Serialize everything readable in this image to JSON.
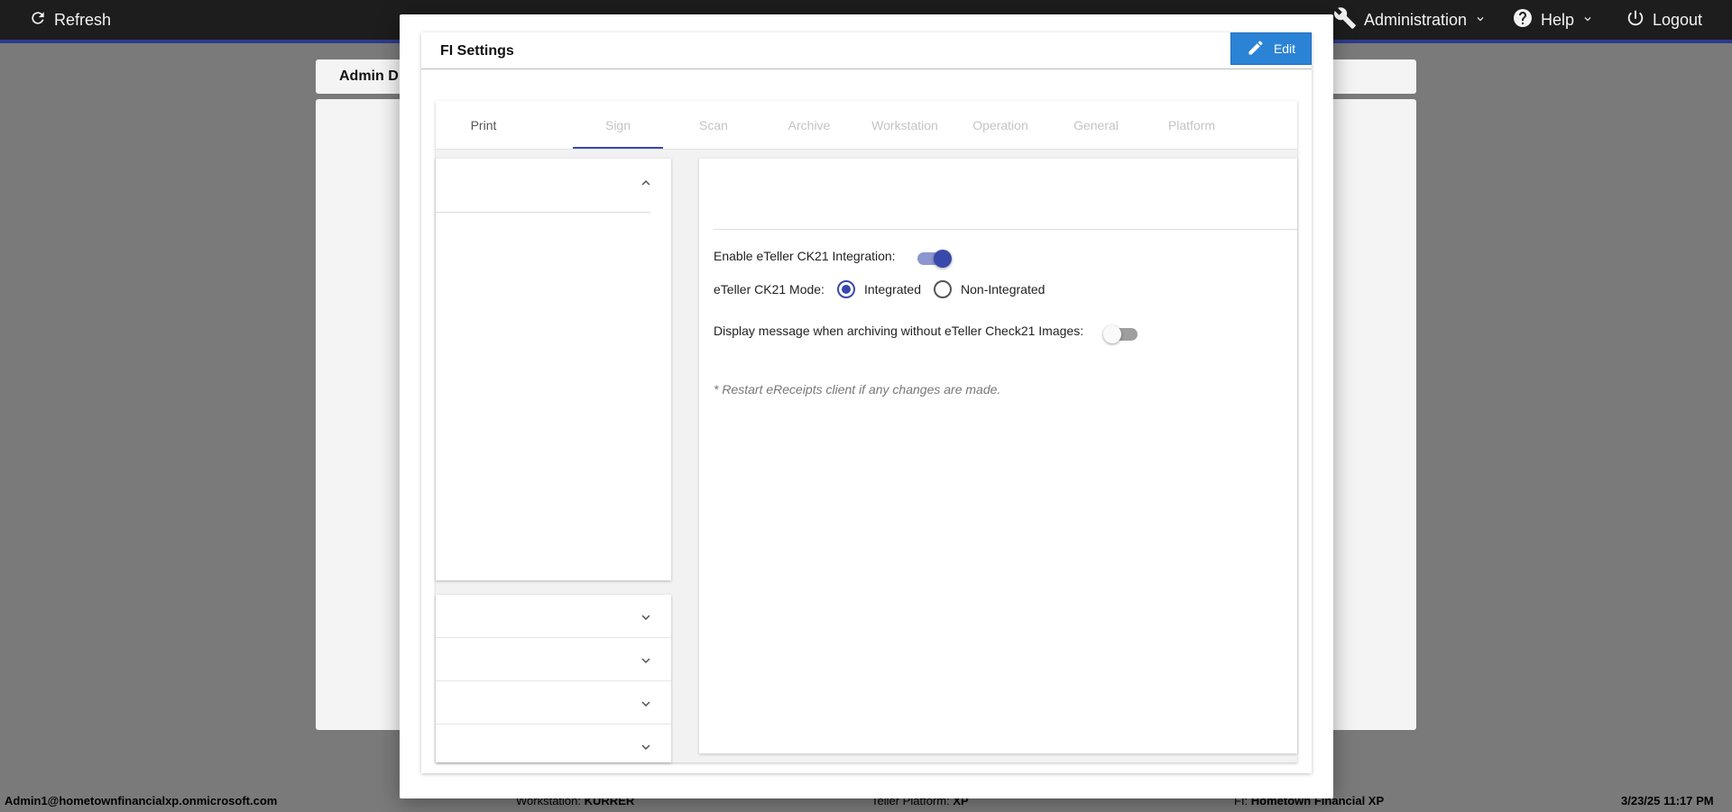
{
  "topbar": {
    "refresh_label": "Refresh",
    "administration_label": "Administration",
    "help_label": "Help",
    "logout_label": "Logout",
    "accent_color": "#2d3a8c"
  },
  "background": {
    "header_title": "Admin D"
  },
  "footer": {
    "user": "Admin1@hometownfinancialxp.onmicrosoft.com",
    "workstation_label": "Workstation:",
    "workstation_value": "KURRER",
    "platform_label": "Teller Platform:",
    "platform_value": "XP",
    "fi_label": "FI:",
    "fi_value": "Hometown Financial XP",
    "datetime": "3/23/25 11:17 PM"
  },
  "modal": {
    "title": "FI Settings",
    "edit_label": "Edit",
    "tabs": [
      {
        "label": "Print"
      },
      {
        "label": "Sign"
      },
      {
        "label": "Scan"
      },
      {
        "label": "Archive"
      },
      {
        "label": "Workstation"
      },
      {
        "label": "Operation"
      },
      {
        "label": "General"
      },
      {
        "label": "Platform"
      }
    ],
    "active_tab": "Print",
    "settings": {
      "enable_ck21_label": "Enable eTeller CK21 Integration:",
      "enable_ck21_on": true,
      "mode_label": "eTeller CK21 Mode:",
      "mode_options": [
        "Integrated",
        "Non-Integrated"
      ],
      "mode_selected": "Integrated",
      "display_msg_label": "Display message when archiving without eTeller Check21 Images:",
      "display_msg_on": false,
      "note": "* Restart eReceipts client if any changes are made."
    }
  }
}
